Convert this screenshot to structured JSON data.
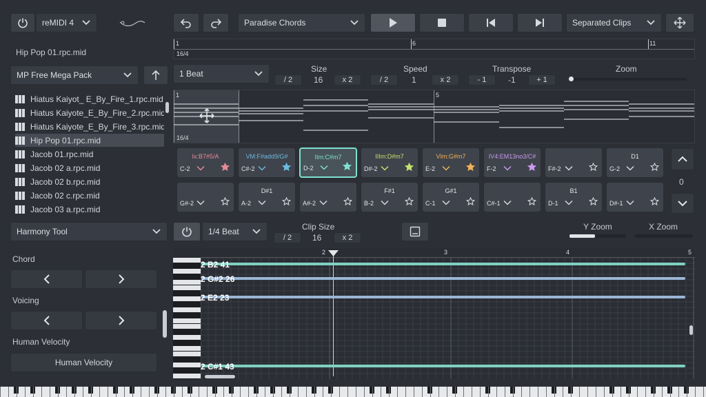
{
  "colors": {
    "accent_teal": "#7fd1c2",
    "accent_blue": "#9ab6d6",
    "pad_red": "#e58a9a",
    "pad_blue": "#6bbbe0",
    "pad_teal": "#7fe0d0",
    "pad_green": "#c2e26b",
    "pad_orange": "#f0b25a",
    "pad_purple": "#c89af0"
  },
  "top": {
    "plugin_name": "reMIDI 4",
    "preset_name": "Paradise Chords",
    "clip_mode": "Separated Clips"
  },
  "file": {
    "current_file": "Hip Pop 01.rpc.mid",
    "pack": "MP Free Mega Pack",
    "list": [
      "Hiatus Kaiyot_ E_By_Fire_1.rpc.mid",
      "Hiatus Kaiyote_E_By_Fire_2.rpc.mid",
      "Hiatus Kaiyote_E_By_Fire_3.rpc.mid",
      "Hip Pop 01.rpc.mid",
      "Jacob 01.rpc.mid",
      "Jacob 02 a.rpc.mid",
      "Jacob 02 b.rpc.mid",
      "Jacob 02 c.rpc.mid",
      "Jacob 03 a.rpc.mid"
    ],
    "selected_index": 3
  },
  "overview": {
    "markers": [
      "1",
      "6",
      "11"
    ],
    "time_sig": "16/4"
  },
  "clip_controls": {
    "grid": "1 Beat",
    "size_label": "Size",
    "size_value": "16",
    "speed_label": "Speed",
    "speed_value": "1",
    "transpose_label": "Transpose",
    "transpose_value": "-1",
    "zoom_label": "Zoom",
    "div2": "/ 2",
    "mul2": "x 2",
    "minus1": "- 1",
    "plus1": "+ 1",
    "zoom_level": 0.02
  },
  "clip_view": {
    "markers": [
      "1",
      "5"
    ],
    "time_sig": "16/4"
  },
  "pads_row1": [
    {
      "name": "Ix:B7#5/A",
      "note": "C-2",
      "star_color": "#e58a9a"
    },
    {
      "name": "VM:F#add9/G#",
      "note": "C#-2",
      "star_color": "#6bbbe0"
    },
    {
      "name": "IIm:C#m7",
      "note": "D-2",
      "star_color": "#7fe0d0"
    },
    {
      "name": "IIIm:D#m7",
      "note": "D#-2",
      "star_color": "#c2e26b"
    },
    {
      "name": "VIm:G#m7",
      "note": "E-2",
      "star_color": "#f0b25a"
    },
    {
      "name": "IV4:EM13no3/C#",
      "note": "F-2",
      "star_color": "#c89af0"
    },
    {
      "name": "",
      "note": "F#-2",
      "star_color": ""
    },
    {
      "name": "D1",
      "note": "G-2",
      "star_color": ""
    }
  ],
  "pads_row2": [
    {
      "name": "",
      "note": "G#-2"
    },
    {
      "name": "D#1",
      "note": "A-2"
    },
    {
      "name": "",
      "note": "A#-2"
    },
    {
      "name": "F#1",
      "note": "B-2"
    },
    {
      "name": "G#1",
      "note": "C-1"
    },
    {
      "name": "",
      "note": "C#-1"
    },
    {
      "name": "B1",
      "note": "D-1"
    },
    {
      "name": "",
      "note": "D#-1"
    }
  ],
  "pad_page": "0",
  "tool": {
    "name": "Harmony Tool",
    "grid": "1/4 Beat",
    "clip_size_label": "Clip Size",
    "clip_size_value": "16",
    "y_zoom": "Y Zoom",
    "x_zoom": "X Zoom",
    "y_zoom_level": 0.45,
    "x_zoom_level": 0.0
  },
  "sidebar": {
    "chord": "Chord",
    "voicing": "Voicing",
    "human_velocity_label": "Human Velocity",
    "human_velocity_button": "Human Velocity"
  },
  "roll": {
    "markers": [
      "2",
      "3",
      "4",
      "5"
    ],
    "notes": [
      {
        "label": "2 B2 41",
        "color": "#7fd1c2"
      },
      {
        "label": "2 G#2 26",
        "color": "#9ab6d6"
      },
      {
        "label": "2 E2 23",
        "color": "#9ab6d6"
      },
      {
        "label": "2 C#1 43",
        "color": "#7fd1c2"
      }
    ]
  }
}
